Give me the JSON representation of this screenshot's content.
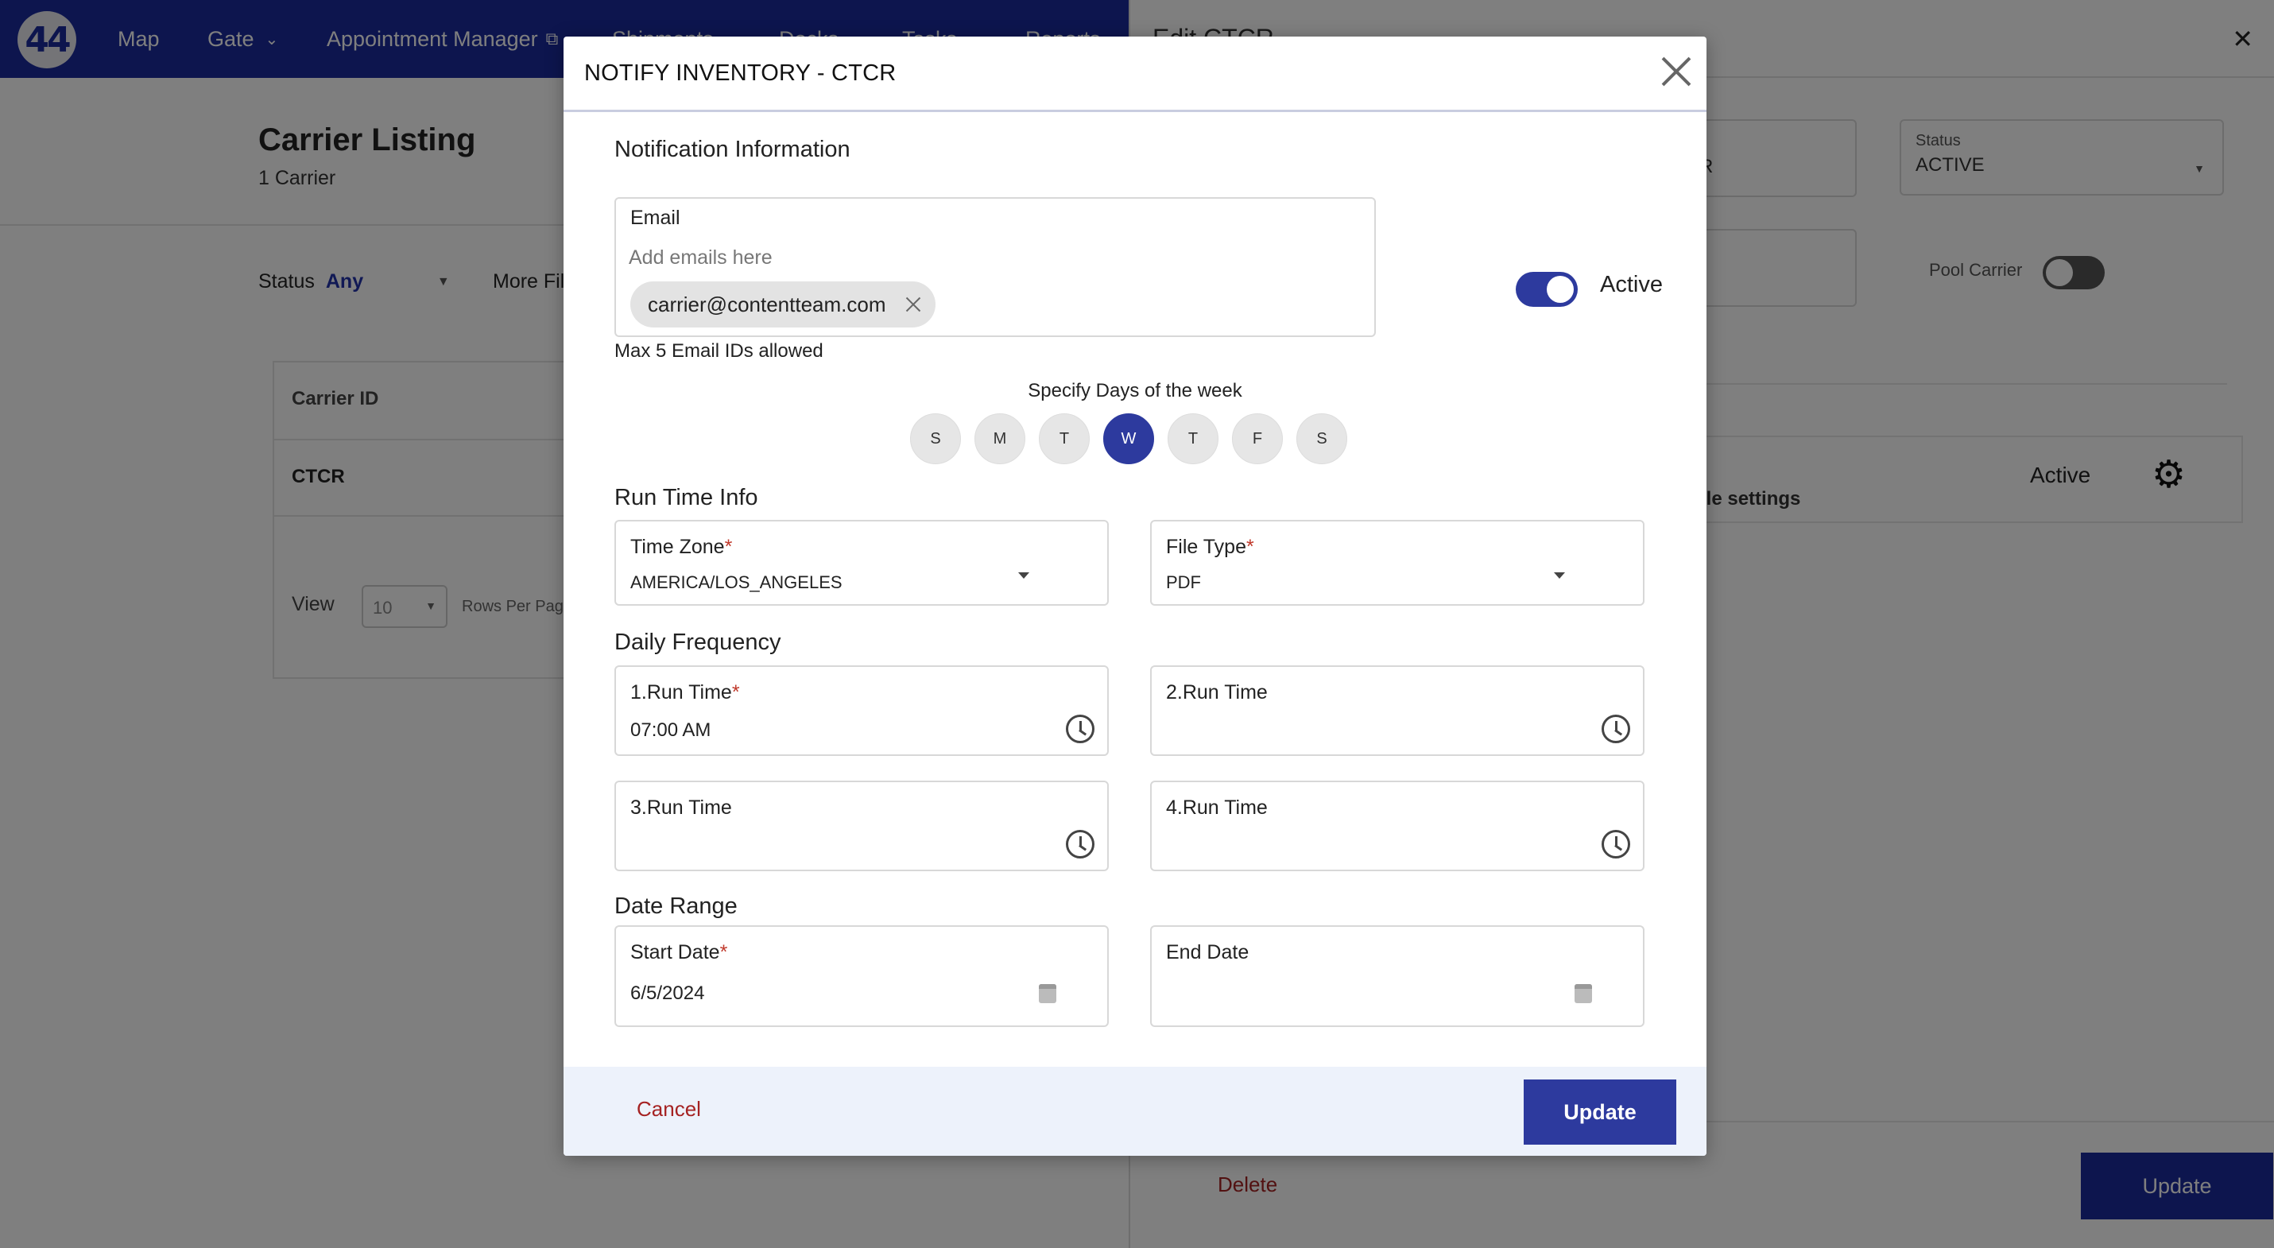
{
  "app": {
    "logo_text": "44",
    "nav": [
      {
        "label": "Map"
      },
      {
        "label": "Gate"
      },
      {
        "label": "Appointment Manager"
      },
      {
        "label": "Shipments"
      },
      {
        "label": "Docks"
      },
      {
        "label": "Tasks"
      },
      {
        "label": "Reports"
      }
    ]
  },
  "listing": {
    "title": "Carrier Listing",
    "count": "1 Carrier",
    "status_label": "Status",
    "status_value": "Any",
    "more_filters": "More Filters",
    "column_header": "Carrier ID",
    "row_value": "CTCR",
    "view_label": "View",
    "rows_value": "10",
    "rows_per_page": "Rows Per Page"
  },
  "drawer": {
    "title": "Edit CTCR",
    "partial_field_value": "ER",
    "status_label": "Status",
    "status_value": "ACTIVE",
    "pool_carrier_label": "Pool Carrier",
    "schedule_text": "ule settings",
    "schedule_status": "Active",
    "delete_label": "Delete",
    "update_label": "Update"
  },
  "modal": {
    "title": "NOTIFY INVENTORY - CTCR",
    "notification_section": "Notification Information",
    "email_label": "Email",
    "email_placeholder": "Add emails here",
    "email_chips": [
      "carrier@contentteam.com"
    ],
    "email_hint": "Max 5 Email IDs allowed",
    "active_label": "Active",
    "active": true,
    "days_label": "Specify Days of the week",
    "days": [
      {
        "label": "S",
        "selected": false
      },
      {
        "label": "M",
        "selected": false
      },
      {
        "label": "T",
        "selected": false
      },
      {
        "label": "W",
        "selected": true
      },
      {
        "label": "T",
        "selected": false
      },
      {
        "label": "F",
        "selected": false
      },
      {
        "label": "S",
        "selected": false
      }
    ],
    "run_time_section": "Run Time Info",
    "time_zone_label": "Time Zone",
    "time_zone_value": "AMERICA/LOS_ANGELES",
    "file_type_label": "File Type",
    "file_type_value": "PDF",
    "daily_frequency_section": "Daily Frequency",
    "run_times": [
      {
        "label": "1.Run Time",
        "value": "07:00 AM",
        "required": true
      },
      {
        "label": "2.Run Time",
        "value": "",
        "required": false
      },
      {
        "label": "3.Run Time",
        "value": "",
        "required": false
      },
      {
        "label": "4.Run Time",
        "value": "",
        "required": false
      }
    ],
    "date_range_section": "Date Range",
    "start_date_label": "Start Date",
    "start_date_value": "6/5/2024",
    "end_date_label": "End Date",
    "end_date_value": "",
    "required_mark": "*",
    "cancel_label": "Cancel",
    "update_label": "Update"
  },
  "colors": {
    "primary": "#2d3a9e",
    "nav_bg": "#1a2a9c",
    "danger": "#a52222",
    "required": "#c0392b"
  },
  "icons": [
    "close-icon",
    "clock-icon",
    "calendar-icon",
    "gear-icon",
    "chevron-down-icon",
    "external-link-icon"
  ]
}
